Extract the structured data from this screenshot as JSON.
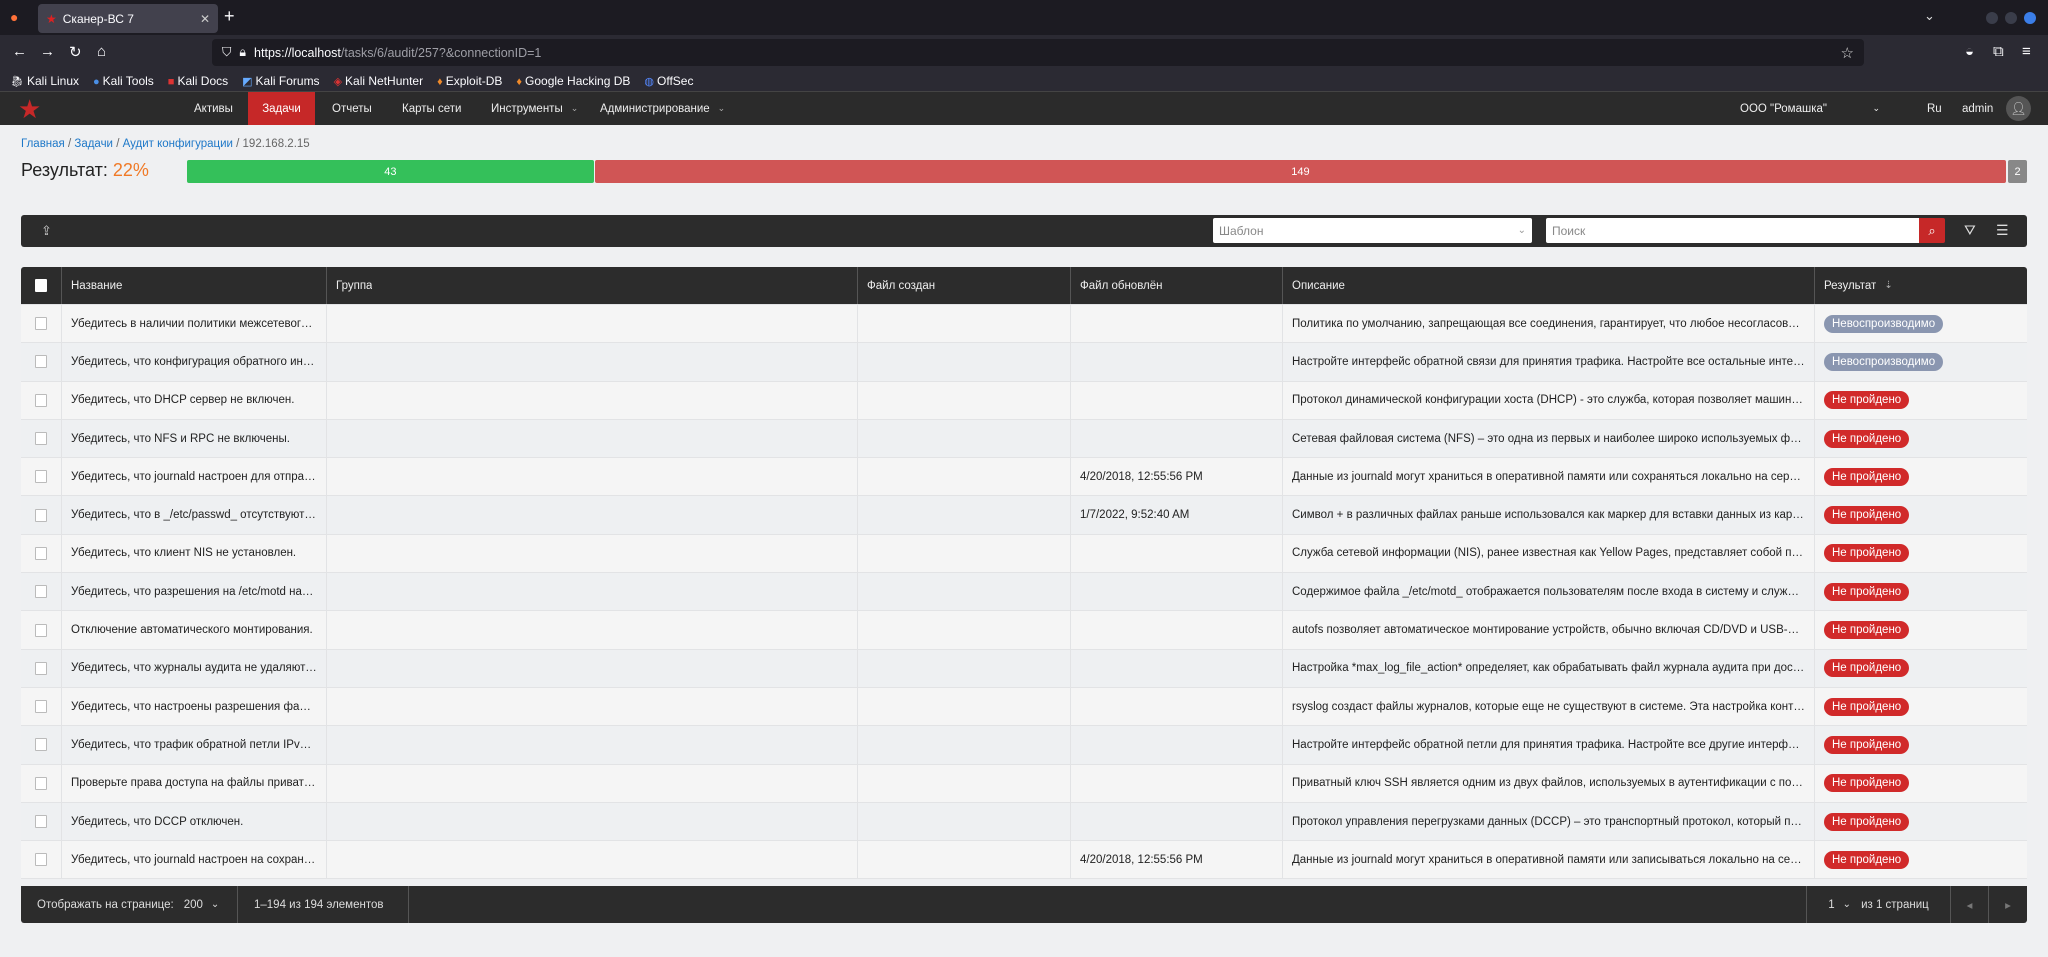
{
  "browser": {
    "tab_title": "Сканер-ВС 7",
    "url_host": "https://localhost",
    "url_path": "/tasks/6/audit/257?&connectionID=1",
    "bookmarks": [
      "Kali Linux",
      "Kali Tools",
      "Kali Docs",
      "Kali Forums",
      "Kali NetHunter",
      "Exploit-DB",
      "Google Hacking DB",
      "OffSec"
    ]
  },
  "nav": {
    "items": [
      "Активы",
      "Задачи",
      "Отчеты",
      "Карты сети",
      "Инструменты",
      "Администрирование"
    ],
    "active": 1,
    "org": "ООО \"Ромашка\"",
    "lang": "Ru",
    "user": "admin"
  },
  "breadcrumb": [
    "Главная",
    "Задачи",
    "Аудит конфигурации",
    "192.168.2.15"
  ],
  "result": {
    "label": "Результат:",
    "percent": "22%",
    "passed": 43,
    "failed": 149,
    "other": 2,
    "colors": {
      "passed": "#34c05a",
      "failed": "#d05555",
      "other": "#888888"
    }
  },
  "toolbar": {
    "template_placeholder": "Шаблон",
    "search_placeholder": "Поиск"
  },
  "table": {
    "headers": [
      "Название",
      "Группа",
      "Файл создан",
      "Файл обновлён",
      "Описание",
      "Результат"
    ],
    "rows": [
      {
        "name": "Убедитесь в наличии политики межсетевого…",
        "group": "",
        "created": "",
        "updated": "",
        "desc": "Политика по умолчанию, запрещающая все соединения, гарантирует, что любое несогласова…",
        "result": "Невоспроизводимо",
        "status": "na"
      },
      {
        "name": "Убедитесь, что конфигурация обратного инт…",
        "group": "",
        "created": "",
        "updated": "",
        "desc": "Настройте интерфейс обратной связи для принятия трафика. Настройте все остальные интер…",
        "result": "Невоспроизводимо",
        "status": "na"
      },
      {
        "name": "Убедитесь, что DHCP сервер не включен.",
        "group": "",
        "created": "",
        "updated": "",
        "desc": "Протокол динамической конфигурации хоста (DHCP) - это служба, которая позволяет машин…",
        "result": "Не пройдено",
        "status": "fail"
      },
      {
        "name": "Убедитесь, что NFS и RPC не включены.",
        "group": "",
        "created": "",
        "updated": "",
        "desc": "Сетевая файловая система (NFS) – это одна из первых и наиболее широко используемых фа…",
        "result": "Не пройдено",
        "status": "fail"
      },
      {
        "name": "Убедитесь, что journald настроен для отправ…",
        "group": "",
        "created": "",
        "updated": "4/20/2018, 12:55:56 PM",
        "desc": "Данные из journald могут храниться в оперативной памяти или сохраняться локально на сер…",
        "result": "Не пройдено",
        "status": "fail"
      },
      {
        "name": "Убедитесь, что в _/etc/passwd_ отсутствуют …",
        "group": "",
        "created": "",
        "updated": "1/7/2022, 9:52:40 AM",
        "desc": "Символ + в различных файлах раньше использовался как маркер для вставки данных из кар…",
        "result": "Не пройдено",
        "status": "fail"
      },
      {
        "name": "Убедитесь, что клиент NIS не установлен.",
        "group": "",
        "created": "",
        "updated": "",
        "desc": "Служба сетевой информации (NIS), ранее известная как Yellow Pages, представляет собой пр…",
        "result": "Не пройдено",
        "status": "fail"
      },
      {
        "name": "Убедитесь, что разрешения на /etc/motd нас…",
        "group": "",
        "created": "",
        "updated": "",
        "desc": "Содержимое файла _/etc/motd_ отображается пользователям после входа в систему и служи…",
        "result": "Не пройдено",
        "status": "fail"
      },
      {
        "name": "Отключение автоматического монтирования.",
        "group": "",
        "created": "",
        "updated": "",
        "desc": "autofs позволяет автоматическое монтирование устройств, обычно включая CD/DVD и USB-н…",
        "result": "Не пройдено",
        "status": "fail"
      },
      {
        "name": "Убедитесь, что журналы аудита не удаляютс…",
        "group": "",
        "created": "",
        "updated": "",
        "desc": "Настройка *max_log_file_action* определяет, как обрабатывать файл журнала аудита при дос…",
        "result": "Не пройдено",
        "status": "fail"
      },
      {
        "name": "Убедитесь, что настроены разрешения файл…",
        "group": "",
        "created": "",
        "updated": "",
        "desc": "rsyslog создаст файлы журналов, которые еще не существуют в системе. Эта настройка конт…",
        "result": "Не пройдено",
        "status": "fail"
      },
      {
        "name": "Убедитесь, что трафик обратной петли IPv6 …",
        "group": "",
        "created": "",
        "updated": "",
        "desc": "Настройте интерфейс обратной петли для принятия трафика. Настройте все другие интерфей…",
        "result": "Не пройдено",
        "status": "fail"
      },
      {
        "name": "Проверьте права доступа на файлы приватн…",
        "group": "",
        "created": "",
        "updated": "",
        "desc": "Приватный ключ SSH является одним из двух файлов, используемых в аутентификации с по…",
        "result": "Не пройдено",
        "status": "fail"
      },
      {
        "name": "Убедитесь, что DCCP отключен.",
        "group": "",
        "created": "",
        "updated": "",
        "desc": "Протокол управления перегрузками данных (DCCP) – это транспортный протокол, который п…",
        "result": "Не пройдено",
        "status": "fail"
      },
      {
        "name": "Убедитесь, что journald настроен на сохране…",
        "group": "",
        "created": "",
        "updated": "4/20/2018, 12:55:56 PM",
        "desc": "Данные из journald могут храниться в оперативной памяти или записываться локально на се…",
        "result": "Не пройдено",
        "status": "fail"
      }
    ],
    "status_colors": {
      "na": "#8a96b0",
      "fail": "#d12a2a"
    }
  },
  "footer": {
    "per_page_label": "Отображать на странице:",
    "per_page": "200",
    "range": "1–194 из 194 элементов",
    "page": "1",
    "pages_label": "из 1 страниц"
  }
}
